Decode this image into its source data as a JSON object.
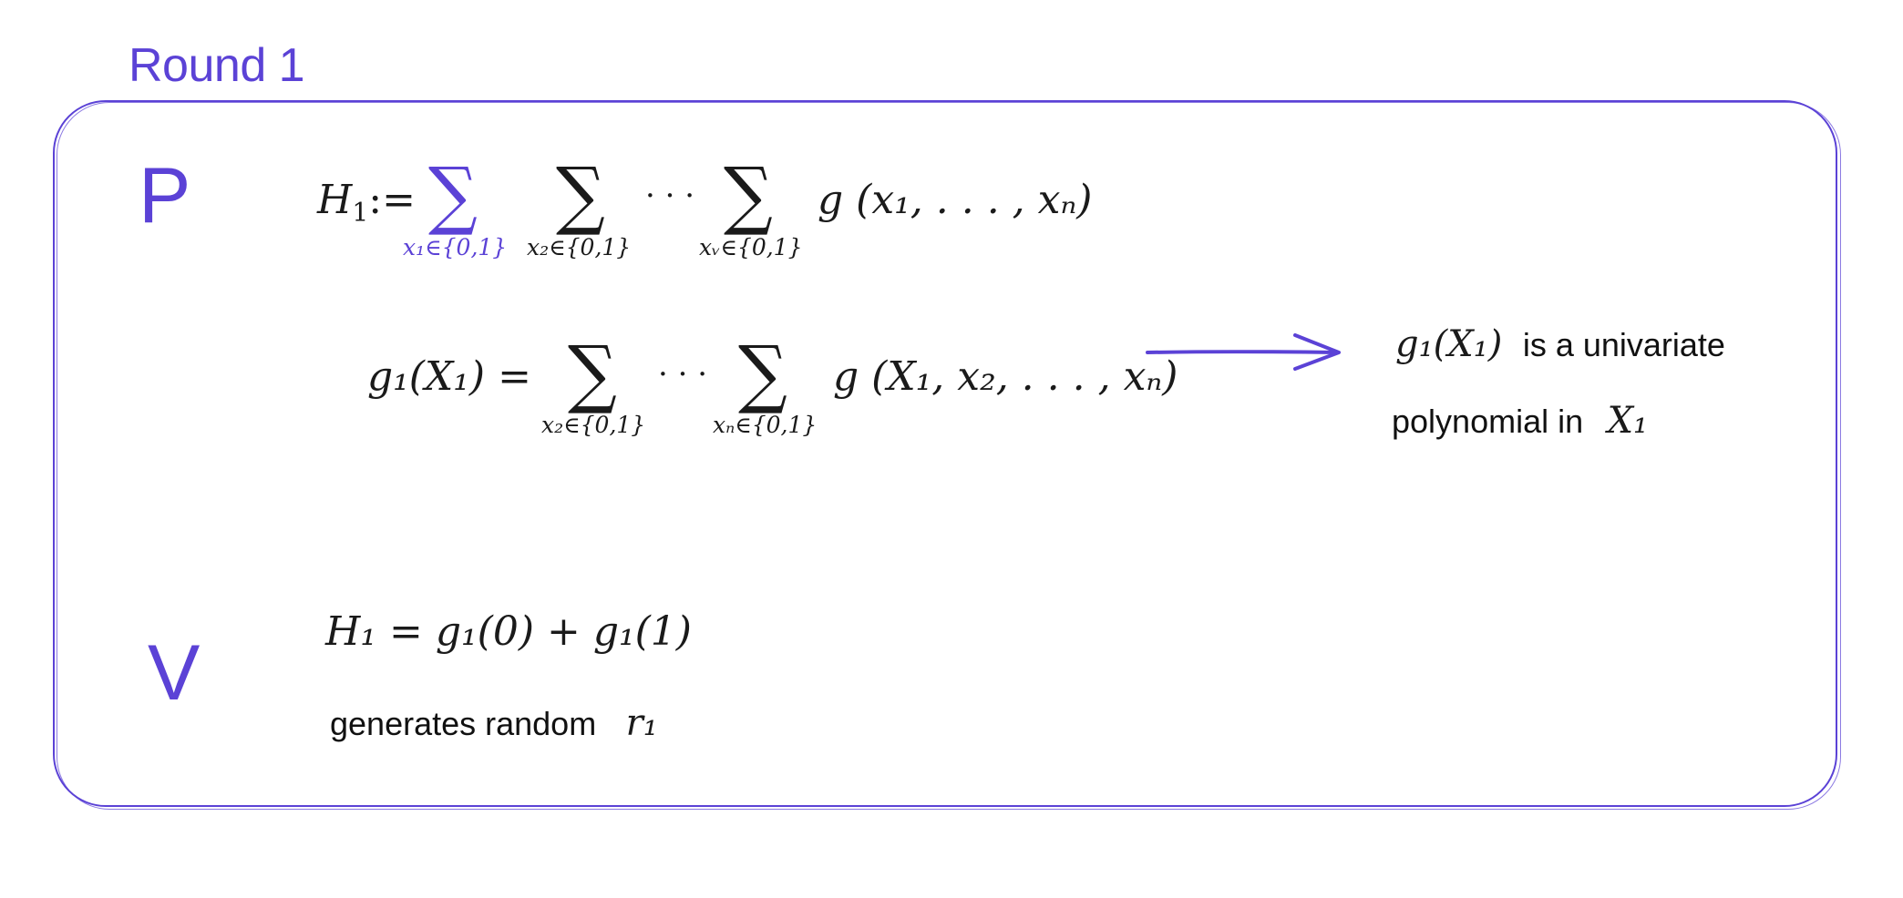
{
  "title": "Round 1",
  "prover": {
    "label": "P",
    "h1_def": {
      "lhs": "H",
      "lhs_sub": "1",
      "assign": ":=",
      "sum1_symbol": "∑",
      "sum1_limit": "x₁∈{0,1}",
      "sum2_symbol": "∑",
      "sum2_limit": "x₂∈{0,1}",
      "dots": "· · ·",
      "sum3_symbol": "∑",
      "sum3_limit": "xᵥ∈{0,1}",
      "rhs": "g (x₁, . . . , xₙ)"
    },
    "g1_def": {
      "lhs": "g₁(X₁) =",
      "sum1_symbol": "∑",
      "sum1_limit": "x₂∈{0,1}",
      "dots": "· · ·",
      "sum2_symbol": "∑",
      "sum2_limit": "xₙ∈{0,1}",
      "rhs": "g (X₁, x₂, . . . , xₙ)"
    },
    "annotation": {
      "math1": "g₁(X₁)",
      "text1": "is a univariate",
      "text2": "polynomial in",
      "math2": "X₁"
    }
  },
  "verifier": {
    "label": "V",
    "check": "H₁ = g₁(0) + g₁(1)",
    "action_text": "generates random",
    "action_math": "r₁"
  },
  "colors": {
    "accent": "#5b42d6",
    "text": "#1a1a1a"
  }
}
